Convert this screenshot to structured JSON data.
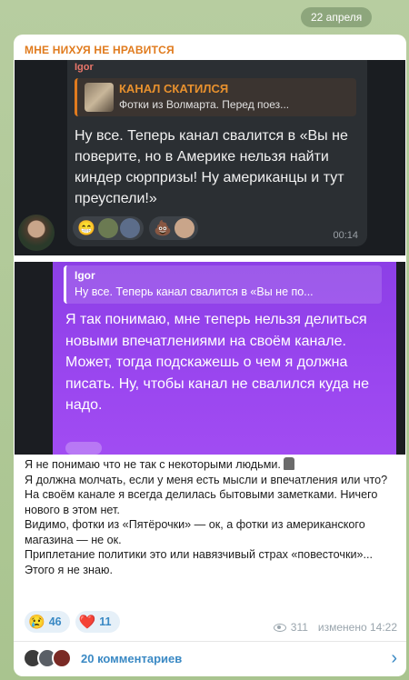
{
  "date_label": "22 апреля",
  "forward_title": "МНЕ НИХУЯ НЕ НРАВИТСЯ",
  "shot1": {
    "sender": "Igor",
    "reply_title": "КАНАЛ СКАТИЛСЯ",
    "reply_snippet": "Фотки из Волмарта. Перед поез...",
    "message": "Ну все. Теперь канал свалится в «Вы не поверите, но в Америке нельзя найти киндер сюрпризы! Ну американцы и тут преуспели!»",
    "time": "00:14"
  },
  "shot2": {
    "reply_name": "Igor",
    "reply_snippet": "Ну все. Теперь канал свалится в «Вы не по...",
    "message_p1": "Я так понимаю, мне теперь нельзя делиться новыми впечатлениями на своём канале.",
    "message_p2": "Может, тогда подскажешь о чем я должна писать. Ну, чтобы канал не свалился куда не надо."
  },
  "caption": {
    "line1": "Я не понимаю что не так с некоторыми людьми.",
    "line2": "Я должна молчать, если у меня есть мысли и впечатления или что?",
    "line3": "На своём канале я всегда делилась бытовыми заметками. Ничего нового в этом нет.",
    "line4": "Видимо, фотки из «Пятёрочки» — ок, а фотки из американского магазина — не ок.",
    "line5": "Приплетание политики это или навязчивый страх «повесточки»... Этого я не знаю."
  },
  "reactions": [
    {
      "emoji": "😢",
      "count": "46"
    },
    {
      "emoji": "❤️",
      "count": "11"
    }
  ],
  "views": "311",
  "edited": "изменено 14:22",
  "comments_label": "20 комментариев"
}
